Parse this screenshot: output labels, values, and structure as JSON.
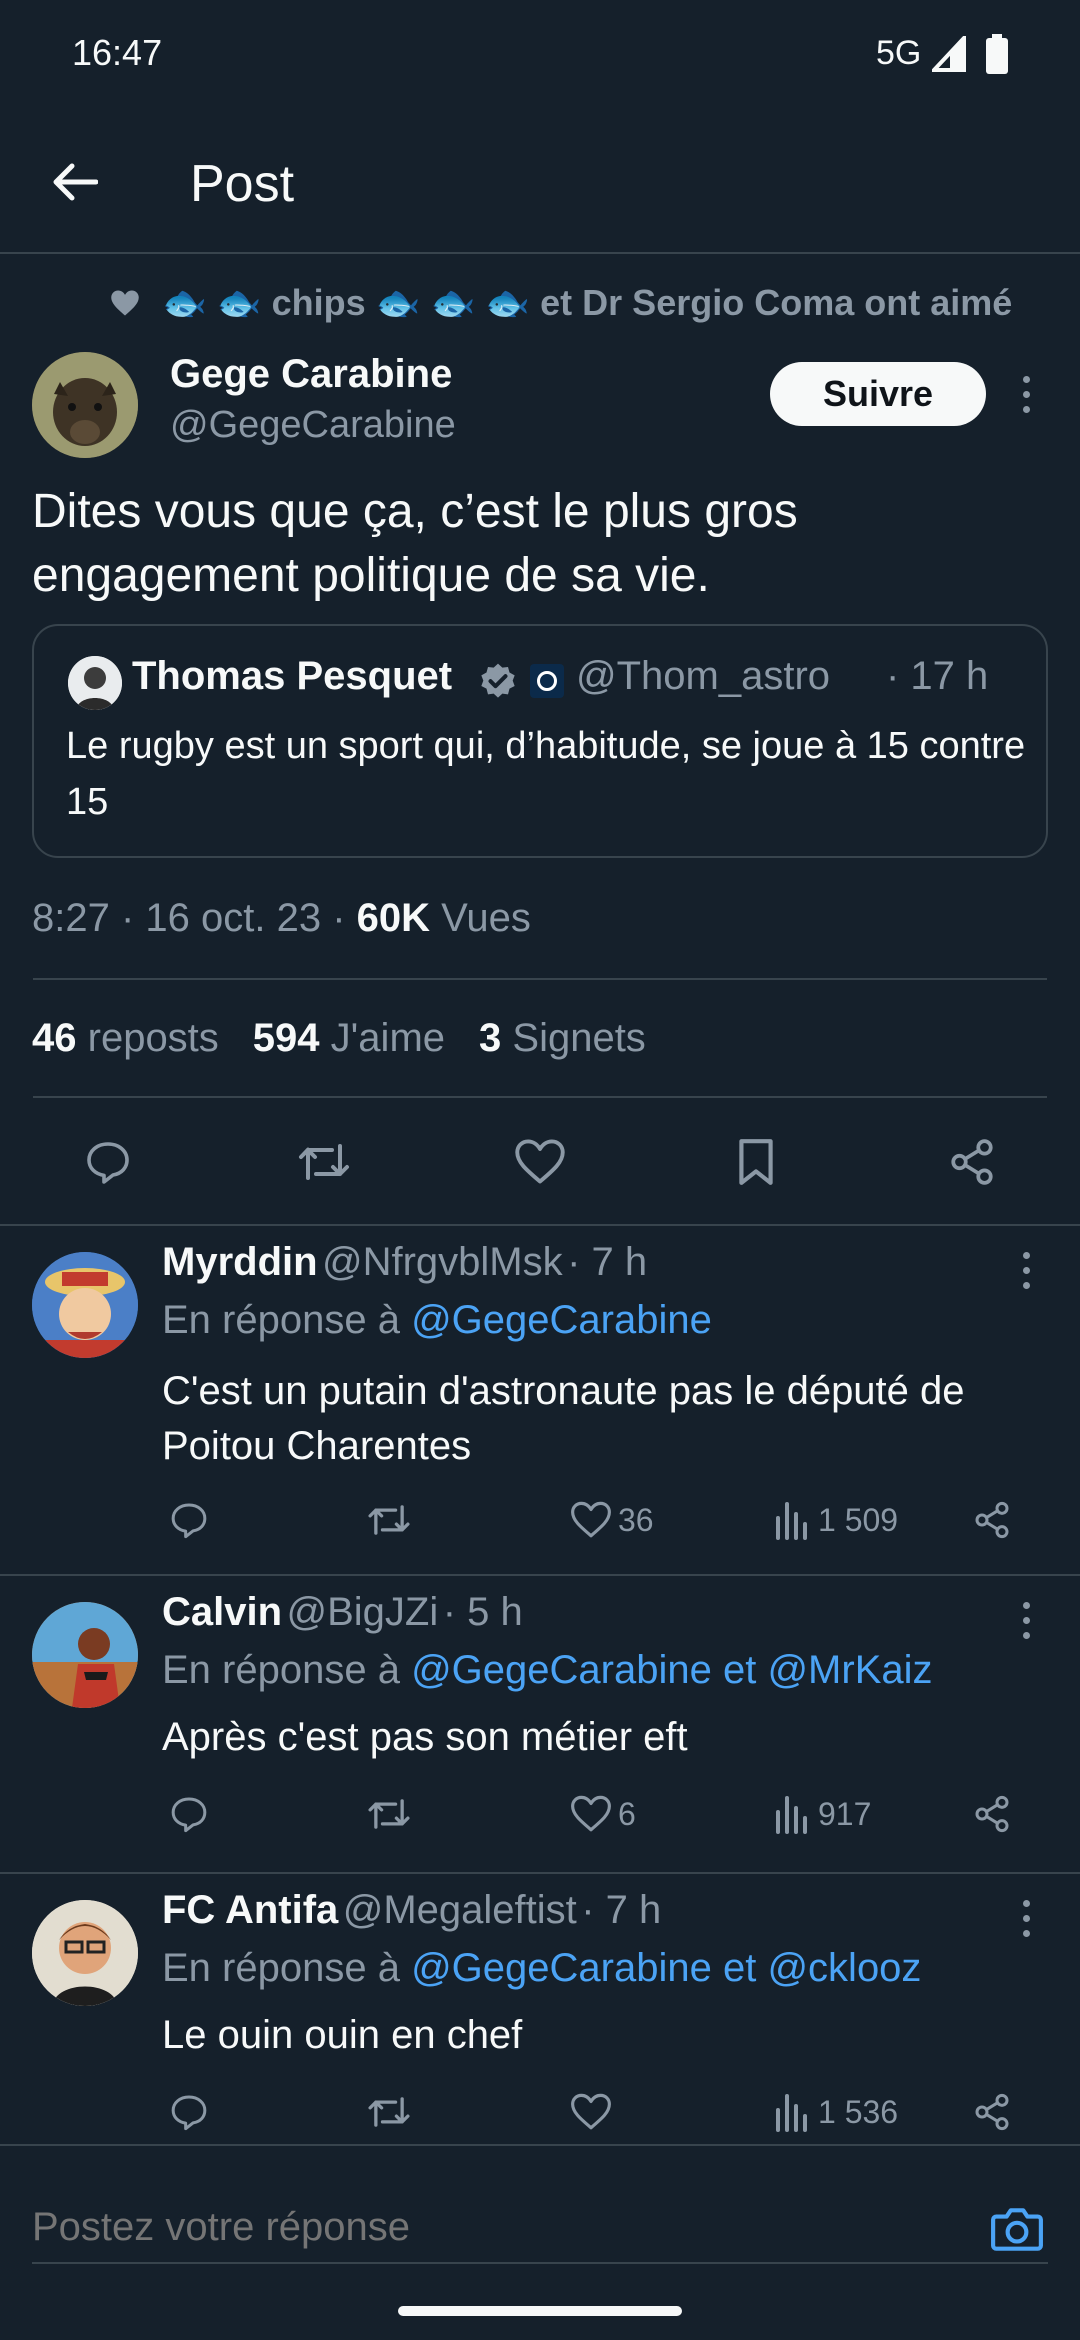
{
  "status_bar": {
    "time": "16:47",
    "network": "5G"
  },
  "header": {
    "title": "Post"
  },
  "post": {
    "liked_by": "🐟 🐟 chips 🐟 🐟 🐟 et Dr Sergio Coma ont aimé",
    "author": {
      "name": "Gege Carabine",
      "handle": "@GegeCarabine"
    },
    "follow_label": "Suivre",
    "text": "Dites vous que ça, c’est le plus gros engagement politique de sa vie.",
    "quote": {
      "name": "Thomas Pesquet",
      "handle": "@Thom_astro",
      "time": "· 17 h",
      "text": "Le rugby est un sport qui, d’habitude, se joue à 15 contre 15"
    },
    "meta": {
      "time": "8:27 · 16 oct. 23 ·",
      "views_count": "60K",
      "views_label": "Vues"
    },
    "stats": {
      "reposts_count": "46",
      "reposts_label": "reposts",
      "likes_count": "594",
      "likes_label": "J'aime",
      "bookmarks_count": "3",
      "bookmarks_label": "Signets"
    }
  },
  "replies": [
    {
      "name": "Myrddin",
      "handle": "@NfrgvblMsk",
      "time": "· 7 h",
      "reply_to_prefix": "En réponse à",
      "reply_to": "@GegeCarabine",
      "text": "C'est un putain d'astronaute pas le député de Poitou Charentes",
      "likes": "36",
      "views": "1 509"
    },
    {
      "name": "Calvin",
      "handle": "@BigJZi",
      "time": "· 5 h",
      "reply_to_prefix": "En réponse à",
      "reply_to": "@GegeCarabine et @MrKaiz",
      "text": "Après c'est pas son métier eft",
      "likes": "6",
      "views": "917"
    },
    {
      "name": "FC Antifa",
      "handle": "@Megaleftist",
      "time": "· 7 h",
      "reply_to_prefix": "En réponse à",
      "reply_to": "@GegeCarabine et @cklooz",
      "text": "Le ouin ouin en chef",
      "likes": "",
      "views": "1 536"
    }
  ],
  "composer": {
    "placeholder": "Postez votre réponse"
  },
  "colors": {
    "background": "#15202b",
    "accent": "#4ba3f5",
    "muted": "#8b98a5",
    "divider": "#38444d"
  }
}
